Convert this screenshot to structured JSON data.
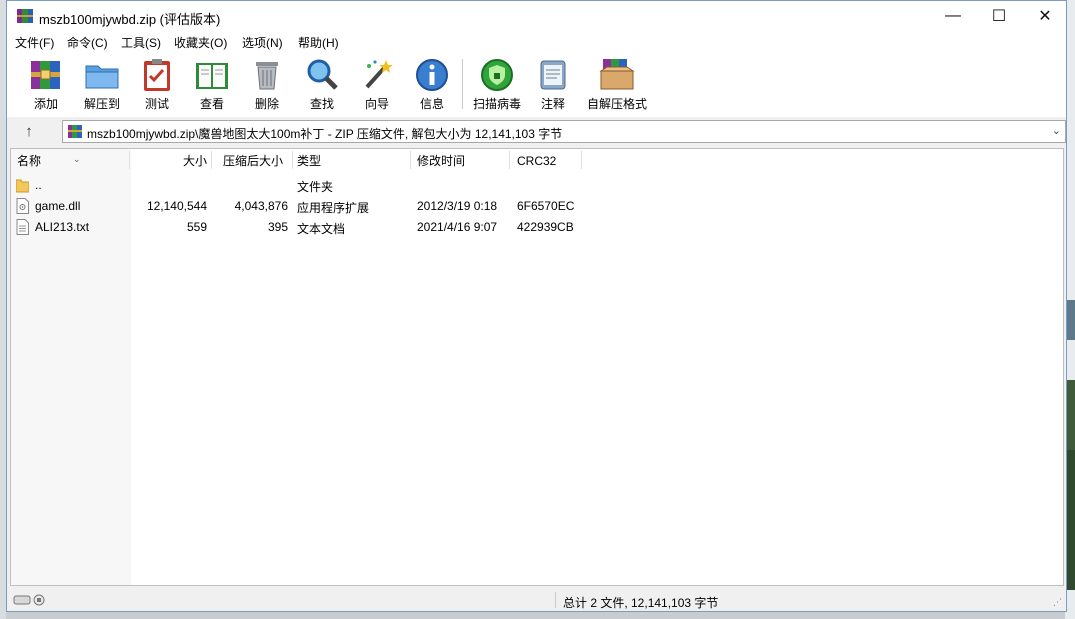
{
  "window": {
    "title": "mszb100mjywbd.zip (评估版本)",
    "controls": {
      "minimize": "—",
      "maximize": "☐",
      "close": "✕"
    }
  },
  "menu": [
    "文件(F)",
    "命令(C)",
    "工具(S)",
    "收藏夹(O)",
    "选项(N)",
    "帮助(H)"
  ],
  "toolbar": [
    {
      "label": "添加",
      "icon": "add-archive-icon"
    },
    {
      "label": "解压到",
      "icon": "extract-to-folder-icon"
    },
    {
      "label": "测试",
      "icon": "test-clipboard-icon"
    },
    {
      "label": "查看",
      "icon": "view-book-icon"
    },
    {
      "label": "删除",
      "icon": "delete-trash-icon"
    },
    {
      "label": "查找",
      "icon": "find-magnifier-icon"
    },
    {
      "label": "向导",
      "icon": "wizard-wand-icon"
    },
    {
      "label": "信息",
      "icon": "info-icon"
    },
    {
      "label": "扫描病毒",
      "icon": "virus-scan-icon"
    },
    {
      "label": "注释",
      "icon": "comment-icon"
    },
    {
      "label": "自解压格式",
      "icon": "sfx-box-icon"
    }
  ],
  "address": {
    "up": "↑",
    "path": "mszb100mjywbd.zip\\魔兽地图太大100m补丁 - ZIP 压缩文件, 解包大小为 12,141,103 字节",
    "dropdown": "⌄"
  },
  "columns": {
    "name": "名称",
    "size": "大小",
    "packed": "压缩后大小",
    "type": "类型",
    "modified": "修改时间",
    "crc": "CRC32"
  },
  "files": [
    {
      "name": "..",
      "size": "",
      "packed": "",
      "type": "文件夹",
      "modified": "",
      "crc": "",
      "icon": "folder-icon"
    },
    {
      "name": "game.dll",
      "size": "12,140,544",
      "packed": "4,043,876",
      "type": "应用程序扩展",
      "modified": "2012/3/19 0:18",
      "crc": "6F6570EC",
      "icon": "dll-file-icon"
    },
    {
      "name": "ALI213.txt",
      "size": "559",
      "packed": "395",
      "type": "文本文档",
      "modified": "2021/4/16 9:07",
      "crc": "422939CB",
      "icon": "text-file-icon"
    }
  ],
  "status": {
    "summary": "总计 2 文件, 12,141,103 字节"
  },
  "colors": {
    "window_border": "#7a9cc4",
    "toolbar_bg": "#ffffff",
    "pane_bg": "#ffffff"
  }
}
